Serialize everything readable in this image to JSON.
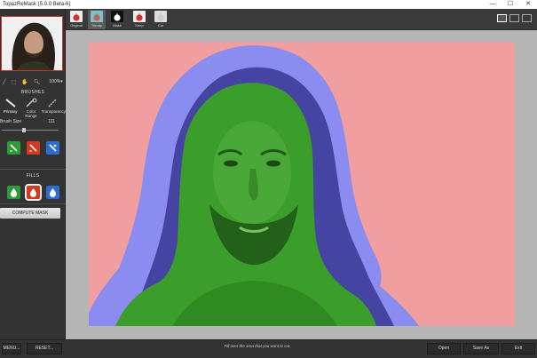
{
  "window": {
    "title": "TopazReMask (5.0.0 Beta-6)",
    "minimize": "—",
    "maximize": "☐",
    "close": "✕"
  },
  "toolbar": {
    "zoom": "100%▾",
    "modes": [
      {
        "label": "Original",
        "icon": "apple-icon",
        "color": "#d83030"
      },
      {
        "label": "Trimap",
        "icon": "apple-icon",
        "color": "#c66060"
      },
      {
        "label": "Mask",
        "icon": "apple-icon",
        "color": "#ffffff"
      },
      {
        "label": "Keep",
        "icon": "apple-icon",
        "color": "#d83030"
      },
      {
        "label": "Cut",
        "icon": "apple-icon",
        "color": "#cccccc"
      }
    ]
  },
  "sidebar": {
    "brushes_title": "BRUSHES",
    "brushes": [
      {
        "label": "Primary"
      },
      {
        "label": "Color Range"
      },
      {
        "label": "Transparency"
      }
    ],
    "brush_size_label": "Brush Size",
    "brush_size_value": "111",
    "brush_size_fraction": 0.38,
    "fills_title": "FILLS",
    "compute_mask_label": "COMPUTE MASK"
  },
  "footer": {
    "menu_label": "MENU...",
    "reset_label": "RESET...",
    "hint": "Fill over the area that you want to cut.",
    "open_label": "Open",
    "save_as_label": "Save As",
    "exit_label": "Exit"
  },
  "colors": {
    "keep": "#2e9a3a",
    "cut": "#d23a1e",
    "compute": "#2c6ed0",
    "cut_overlay": "#f09ea0",
    "compute_overlay": "#8a8cf0",
    "keep_overlay": "#3c9e2a"
  }
}
